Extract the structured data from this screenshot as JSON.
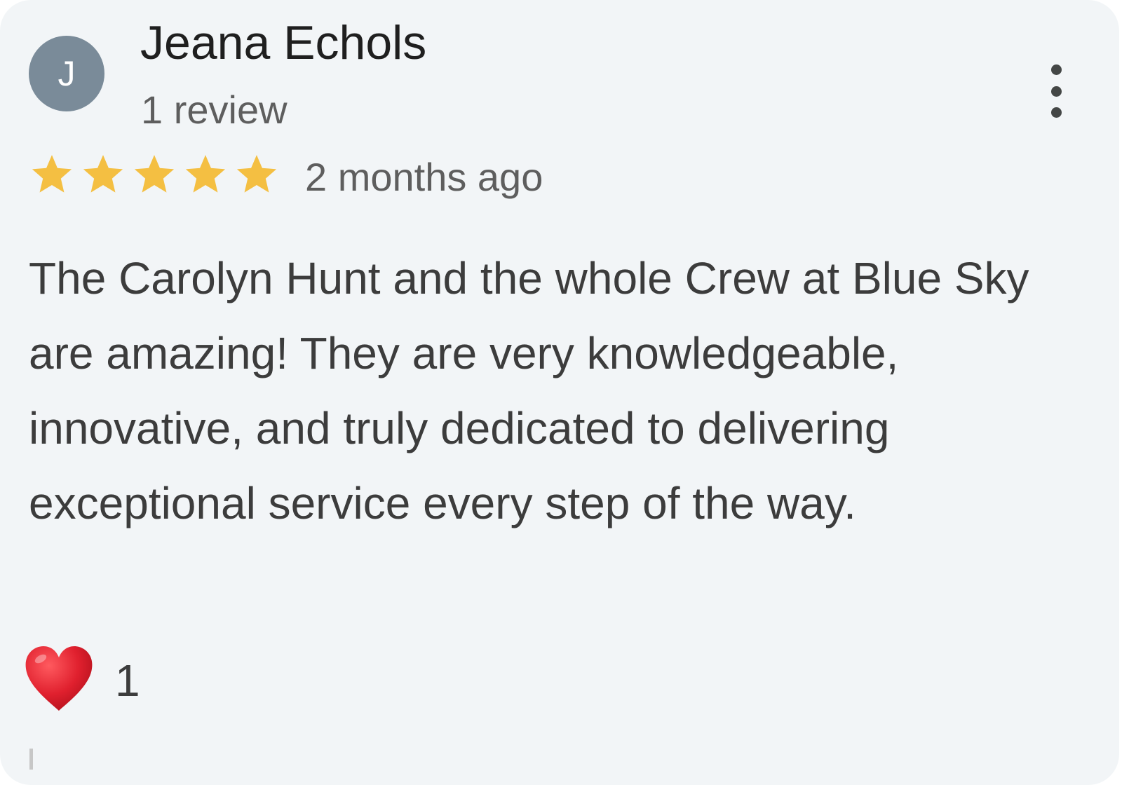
{
  "review": {
    "avatar_initial": "J",
    "reviewer_name": "Jeana Echols",
    "review_count": "1 review",
    "rating": 5,
    "rating_max": 5,
    "date": "2 months ago",
    "text": "The Carolyn Hunt and the whole Crew at Blue Sky are amazing! They are very knowledgeable, innovative, and truly dedicated to delivering exceptional service every step of the way.",
    "reaction": {
      "icon": "heart-icon",
      "count": "1"
    },
    "more_icon": "more-vert-icon"
  },
  "colors": {
    "card_background": "#f2f5f7",
    "avatar_background": "#7a8b99",
    "star": "#f4bf42",
    "heart": "#d81e2c"
  }
}
